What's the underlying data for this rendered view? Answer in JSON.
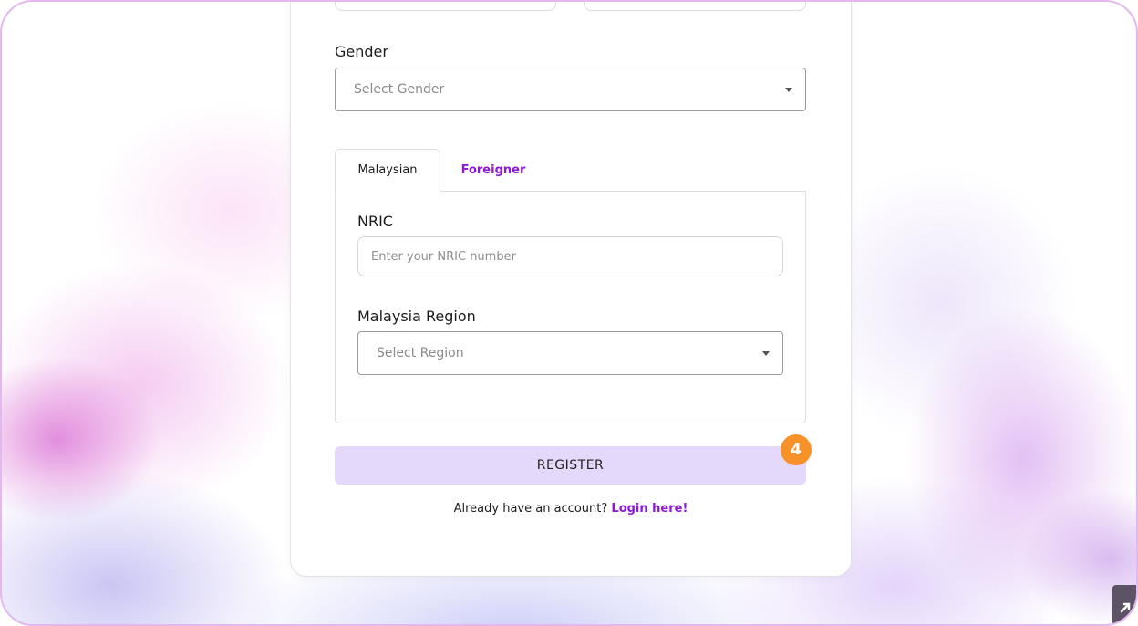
{
  "form": {
    "gender_label": "Gender",
    "gender_placeholder": "Select Gender",
    "tabs": [
      {
        "label": "Malaysian",
        "active": true
      },
      {
        "label": "Foreigner",
        "active": false
      }
    ],
    "nric_label": "NRIC",
    "nric_placeholder": "Enter your NRIC number",
    "region_label": "Malaysia Region",
    "region_placeholder": "Select Region",
    "register_label": "REGISTER",
    "step_badge": "4",
    "footer_text": "Already have an account?",
    "login_link": "Login here!"
  },
  "colors": {
    "accent": "#8f18d6",
    "register_bg": "#e5d9fb",
    "badge": "#f7922b"
  },
  "icons": {
    "select_caret": "chevron-down-icon",
    "corner": "arrow-icon"
  }
}
